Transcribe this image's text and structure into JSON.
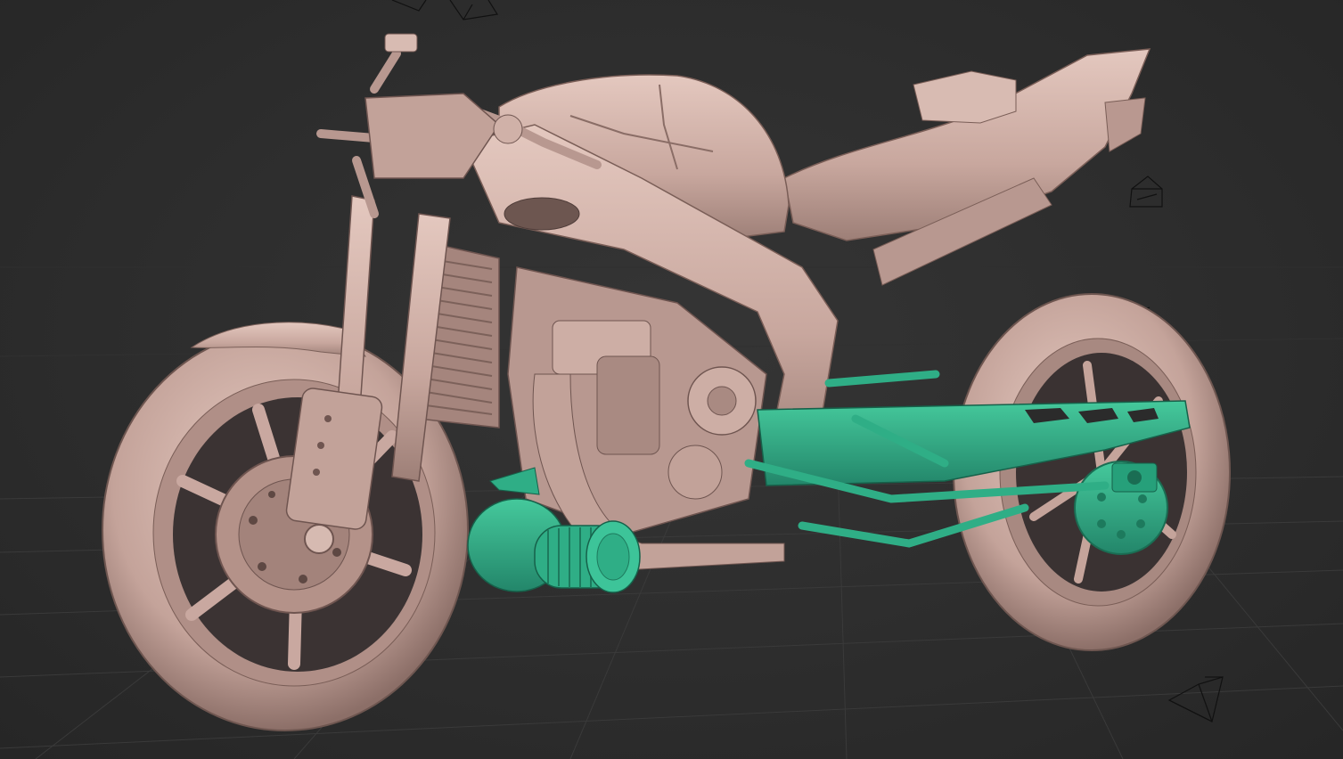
{
  "viewport": {
    "mode": "sculpt",
    "background_color": "#2d2d2d",
    "grid_color": "#3a3a3a",
    "grid_visible": true
  },
  "model": {
    "object": "motorcycle",
    "material_color": "#c9a79e",
    "material_highlight": "#e2c6bd",
    "material_shadow": "#7e625b",
    "selection_color": "#2fae86",
    "selection_shadow": "#1d7a5d",
    "selected_parts": [
      "turbo-air-filter",
      "swingarm",
      "subframe-bars"
    ]
  },
  "scene_gizmos": [
    "camera-gizmo-icon",
    "camera-gizmo-icon",
    "camera-gizmo-icon",
    "camera-gizmo-icon"
  ]
}
